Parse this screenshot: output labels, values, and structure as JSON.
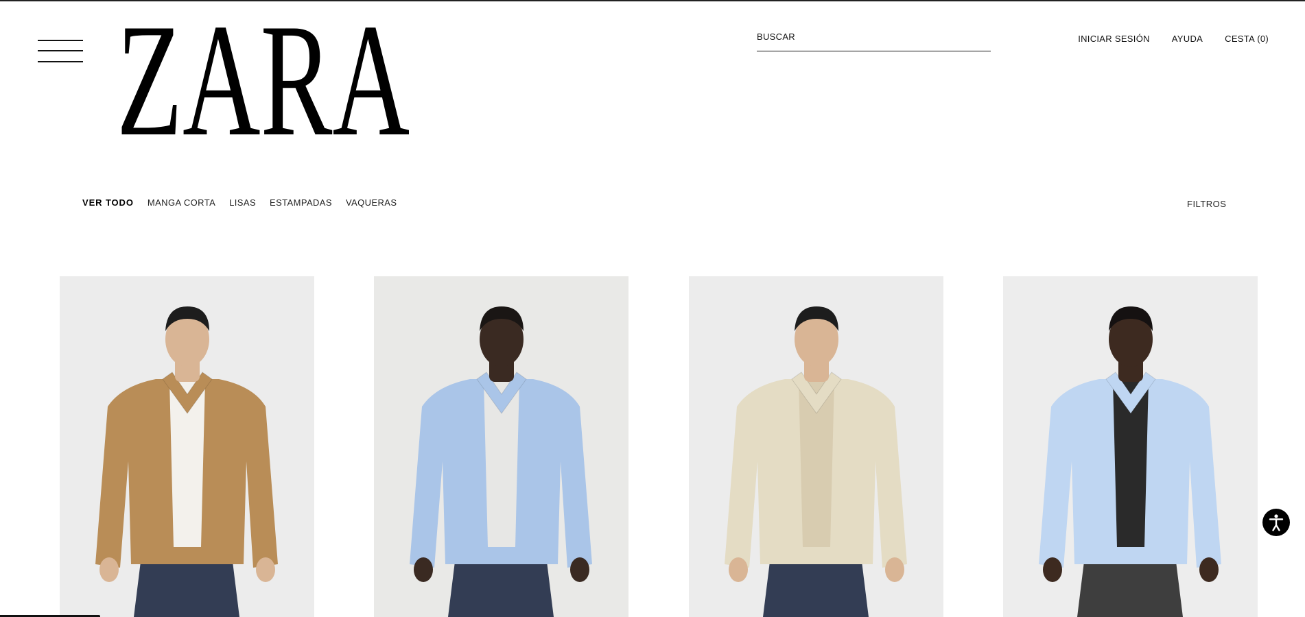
{
  "header": {
    "logo_text": "ZARA",
    "search_label": "BUSCAR",
    "links": [
      "INICIAR SESIÓN",
      "AYUDA",
      "CESTA (0)"
    ]
  },
  "categories": {
    "items": [
      "VER TODO",
      "MANGA CORTA",
      "LISAS",
      "ESTAMPADAS",
      "VAQUERAS"
    ],
    "active": "VER TODO",
    "filters_label": "FILTROS"
  },
  "products": [
    {
      "name": "camel overshirt",
      "colors": {
        "bg": "#ececec",
        "garment": "#b98d57",
        "under": "#f3f1ec",
        "skin": "#d9b595",
        "hair": "#1d1d1d"
      }
    },
    {
      "name": "light blue shirt",
      "colors": {
        "bg": "#e9e9e7",
        "garment": "#aac5e8",
        "under": "#e7e7e5",
        "skin": "#3a2a22",
        "hair": "#1a1614"
      }
    },
    {
      "name": "striped beige shirt",
      "colors": {
        "bg": "#ececec",
        "garment": "#e4dcc4",
        "under": "#d8ccb0",
        "skin": "#d9b595",
        "hair": "#1d1d1d"
      }
    },
    {
      "name": "pale blue shirt",
      "colors": {
        "bg": "#ededed",
        "garment": "#bfd6f2",
        "under": "#2a2a2a",
        "skin": "#3d2a20",
        "hair": "#151111"
      }
    }
  ]
}
